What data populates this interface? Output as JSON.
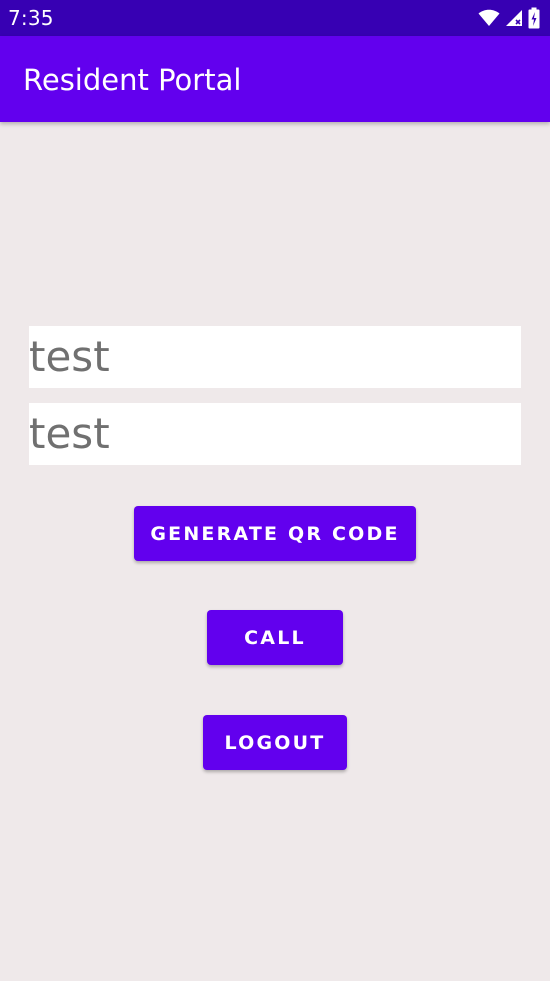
{
  "status_bar": {
    "time": "7:35",
    "icons": [
      "wifi-icon",
      "cellular-signal-icon",
      "battery-charging-icon"
    ]
  },
  "app_bar": {
    "title": "Resident Portal"
  },
  "form": {
    "field_1_value": "test",
    "field_2_value": "test"
  },
  "buttons": {
    "generate_label": "GENERATE QR CODE",
    "call_label": "CALL",
    "logout_label": "LOGOUT"
  },
  "colors": {
    "primary": "#6200ee",
    "primary_dark": "#3700b3",
    "background": "#efe9ea",
    "field_background": "#ffffff",
    "field_text": "#707070"
  }
}
